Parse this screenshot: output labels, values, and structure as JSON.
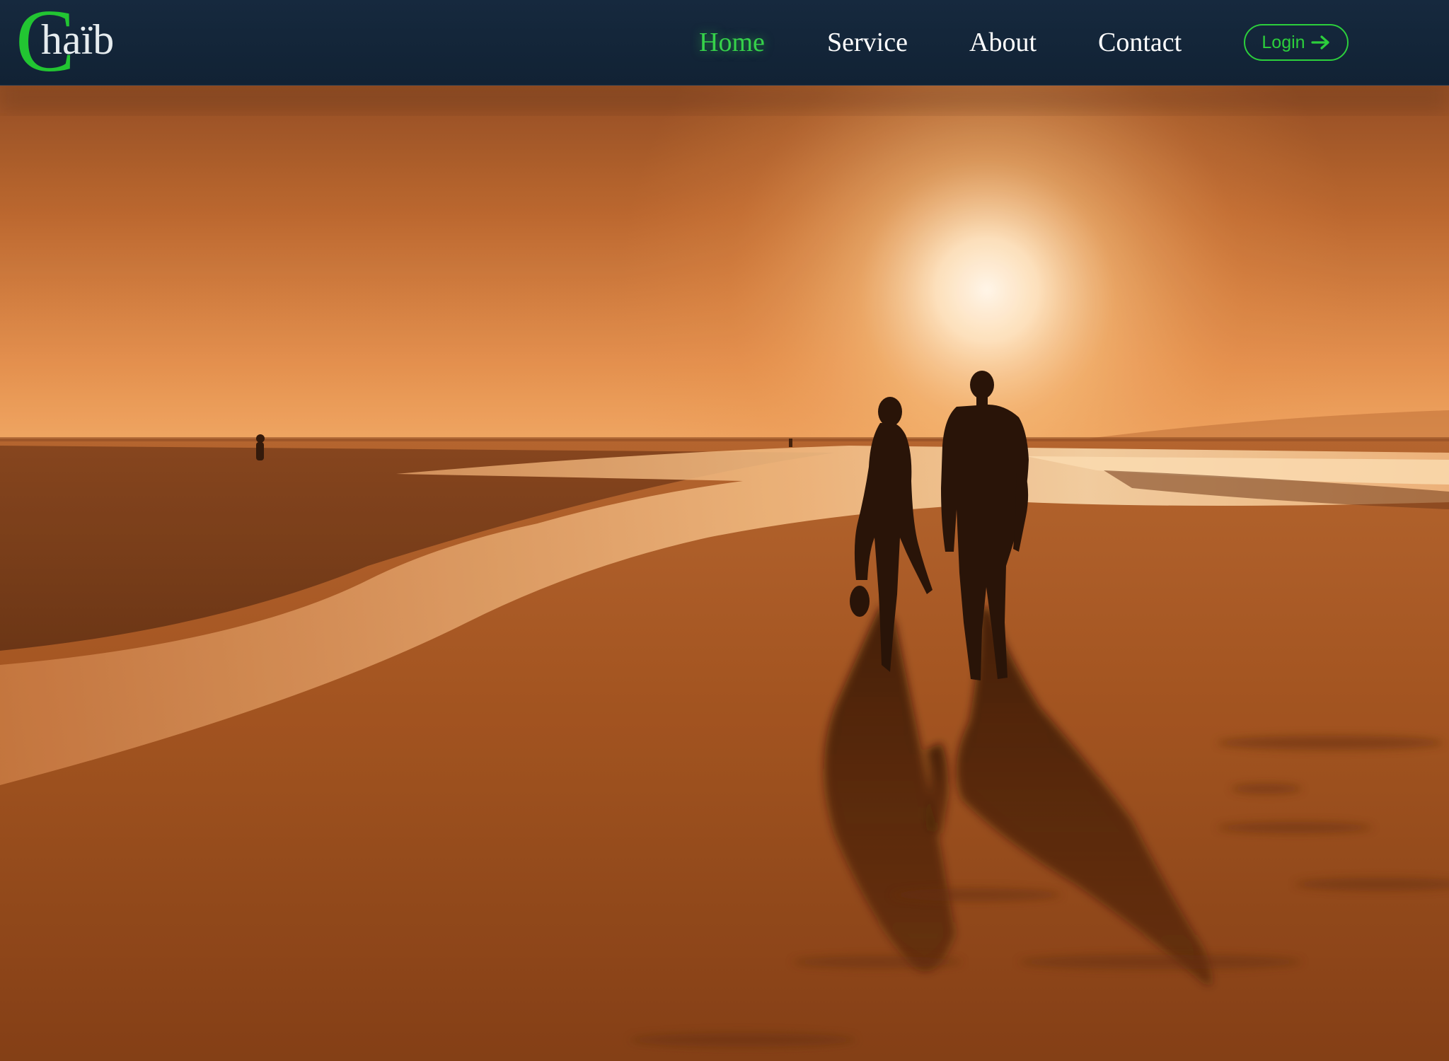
{
  "brand": {
    "initial": "C",
    "rest": "haïb",
    "initial_color": "#22c532",
    "rest_color": "#e6ecef"
  },
  "nav": {
    "items": [
      {
        "label": "Home",
        "active": true
      },
      {
        "label": "Service",
        "active": false
      },
      {
        "label": "About",
        "active": false
      },
      {
        "label": "Contact",
        "active": false
      }
    ],
    "login_label": "Login",
    "login_icon": "arrow-right-icon",
    "accent_color": "#2ccf3c",
    "background_color": "#13263a"
  },
  "hero": {
    "image_subject": "sunset-beach-couple-silhouette",
    "palette": {
      "sky": "#c8743a",
      "sun": "#fff3dc",
      "sand": "#a85a26",
      "shadow": "#2a1206"
    }
  }
}
